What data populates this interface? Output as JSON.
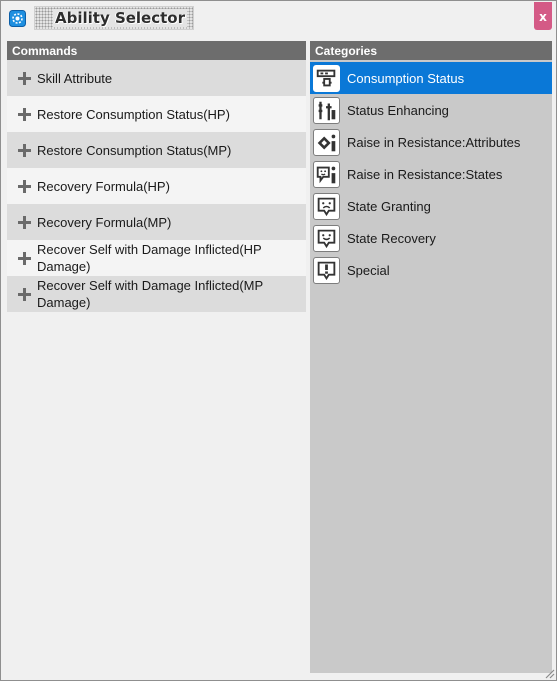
{
  "window": {
    "title": "Ability Selector",
    "close_symbol": "x",
    "app_icon": "gear-icon"
  },
  "commands": {
    "header": "Commands",
    "items": [
      {
        "label": "Skill Attribute"
      },
      {
        "label": "Restore Consumption Status(HP)"
      },
      {
        "label": "Restore Consumption Status(MP)"
      },
      {
        "label": "Recovery Formula(HP)"
      },
      {
        "label": "Recovery Formula(MP)"
      },
      {
        "label": "Recover Self with Damage Inflicted(HP Damage)"
      },
      {
        "label": "Recover Self with Damage Inflicted(MP Damage)"
      }
    ]
  },
  "categories": {
    "header": "Categories",
    "selected_index": 0,
    "items": [
      {
        "label": "Consumption Status",
        "icon": "consumption-status-icon"
      },
      {
        "label": "Status Enhancing",
        "icon": "status-enhancing-icon"
      },
      {
        "label": "Raise in Resistance:Attributes",
        "icon": "resistance-attributes-icon"
      },
      {
        "label": "Raise in Resistance:States",
        "icon": "resistance-states-icon"
      },
      {
        "label": "State Granting",
        "icon": "state-granting-icon"
      },
      {
        "label": "State Recovery",
        "icon": "state-recovery-icon"
      },
      {
        "label": "Special",
        "icon": "special-icon"
      }
    ]
  },
  "colors": {
    "selection": "#0a78d7",
    "close_button": "#d45a86",
    "header": "#6d6d6d"
  }
}
